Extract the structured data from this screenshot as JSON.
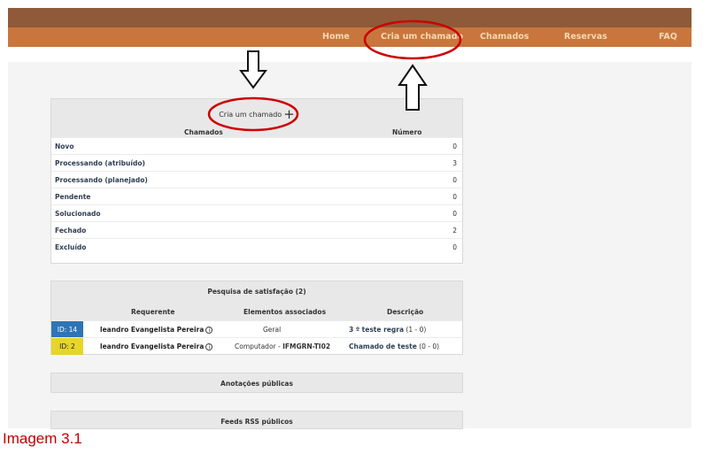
{
  "nav": {
    "items": [
      {
        "label": "Home"
      },
      {
        "label": "Cria um chamado"
      },
      {
        "label": "Chamados"
      },
      {
        "label": "Reservas"
      },
      {
        "label": "FAQ"
      }
    ]
  },
  "tickets_panel": {
    "title": "Cria um chamado",
    "plus_glyph": "+",
    "col_status": "Chamados",
    "col_count": "Número",
    "rows": [
      {
        "label": "Novo",
        "count": "0"
      },
      {
        "label": "Processando (atribuído)",
        "count": "3"
      },
      {
        "label": "Processando (planejado)",
        "count": "0"
      },
      {
        "label": "Pendente",
        "count": "0"
      },
      {
        "label": "Solucionado",
        "count": "0"
      },
      {
        "label": "Fechado",
        "count": "2"
      },
      {
        "label": "Excluído",
        "count": "0"
      }
    ]
  },
  "survey_panel": {
    "title": "Pesquisa de satisfação (2)",
    "col_requester": "Requerente",
    "col_elements": "Elementos associados",
    "col_description": "Descrição",
    "rows": [
      {
        "id": "ID: 14",
        "id_color": "#2e75b6",
        "requester": "leandro Evangelista Pereira",
        "element_prefix": "Geral",
        "element_bold": "",
        "desc_link": "3 º teste regra",
        "desc_suffix": "(1 - 0)"
      },
      {
        "id": "ID: 2",
        "id_color": "#e6d52a",
        "requester": "leandro Evangelista Pereira",
        "element_prefix": "Computador - ",
        "element_bold": "IFMGRN-TI02",
        "desc_link": "Chamado de teste",
        "desc_suffix": "(0 - 0)"
      }
    ],
    "info_glyph": "i"
  },
  "notes_panel": {
    "title": "Anotações públicas"
  },
  "rss_panel": {
    "title": "Feeds RSS públicos"
  },
  "annotation": {
    "caption": "Imagem 3.1",
    "color": "#cc0000"
  },
  "colors": {
    "topbar": "#8e5a3a",
    "navbar": "#c8763e",
    "nav_text": "#f6d9b3",
    "link": "#2f3e54"
  }
}
